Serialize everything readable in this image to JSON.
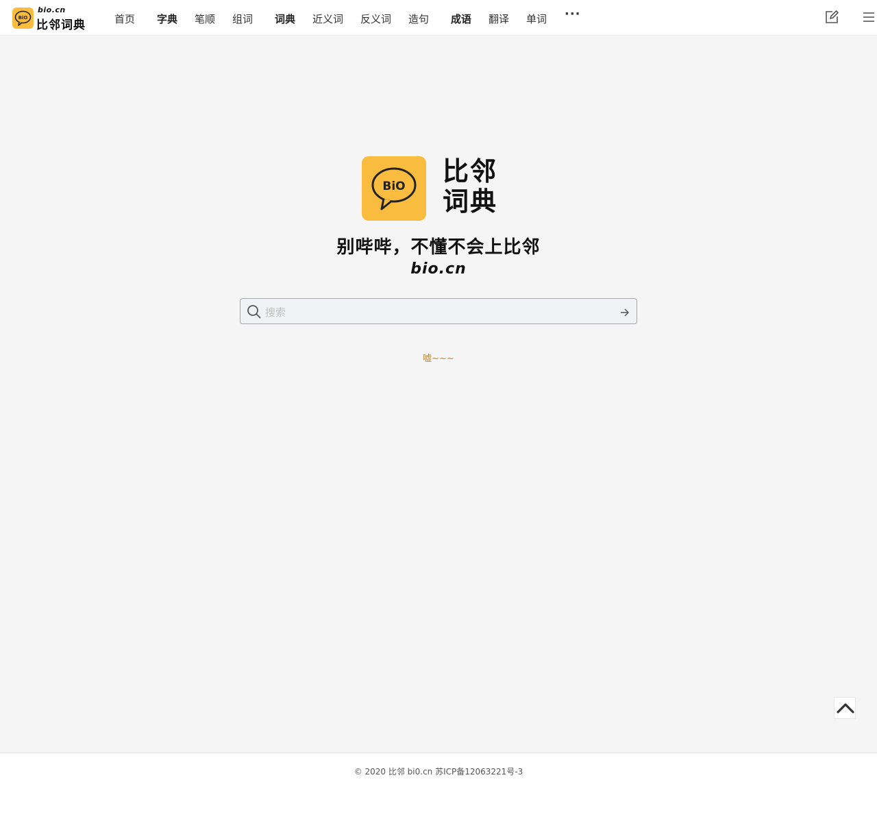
{
  "header": {
    "brand": {
      "domain": "bio.cn",
      "name": "比邻词典",
      "logo_text": "BiO"
    },
    "nav": [
      {
        "label": "首页",
        "bold": false
      },
      {
        "label": "字典",
        "bold": true
      },
      {
        "label": "笔顺",
        "bold": false
      },
      {
        "label": "组词",
        "bold": false
      },
      {
        "label": "词典",
        "bold": true
      },
      {
        "label": "近义词",
        "bold": false
      },
      {
        "label": "反义词",
        "bold": false
      },
      {
        "label": "造句",
        "bold": false
      },
      {
        "label": "成语",
        "bold": true
      },
      {
        "label": "翻译",
        "bold": false
      },
      {
        "label": "单词",
        "bold": false
      }
    ],
    "more_label": "···",
    "icons": {
      "edit": "edit-icon",
      "menu": "menu-icon"
    }
  },
  "hero": {
    "logo_text": "BiO",
    "name_line1": "比邻",
    "name_line2": "词典",
    "slogan": "别哔哔，不懂不会上比邻",
    "domain": "bio.cn"
  },
  "search": {
    "placeholder": "搜索",
    "value": ""
  },
  "hint": "嘘~~~",
  "footer": {
    "text": "© 2020 比邻 bi0.cn 苏ICP备12063221号-3"
  },
  "colors": {
    "accent": "#f9bc3e",
    "background": "#f5f5f5",
    "hint": "#b8873a"
  }
}
